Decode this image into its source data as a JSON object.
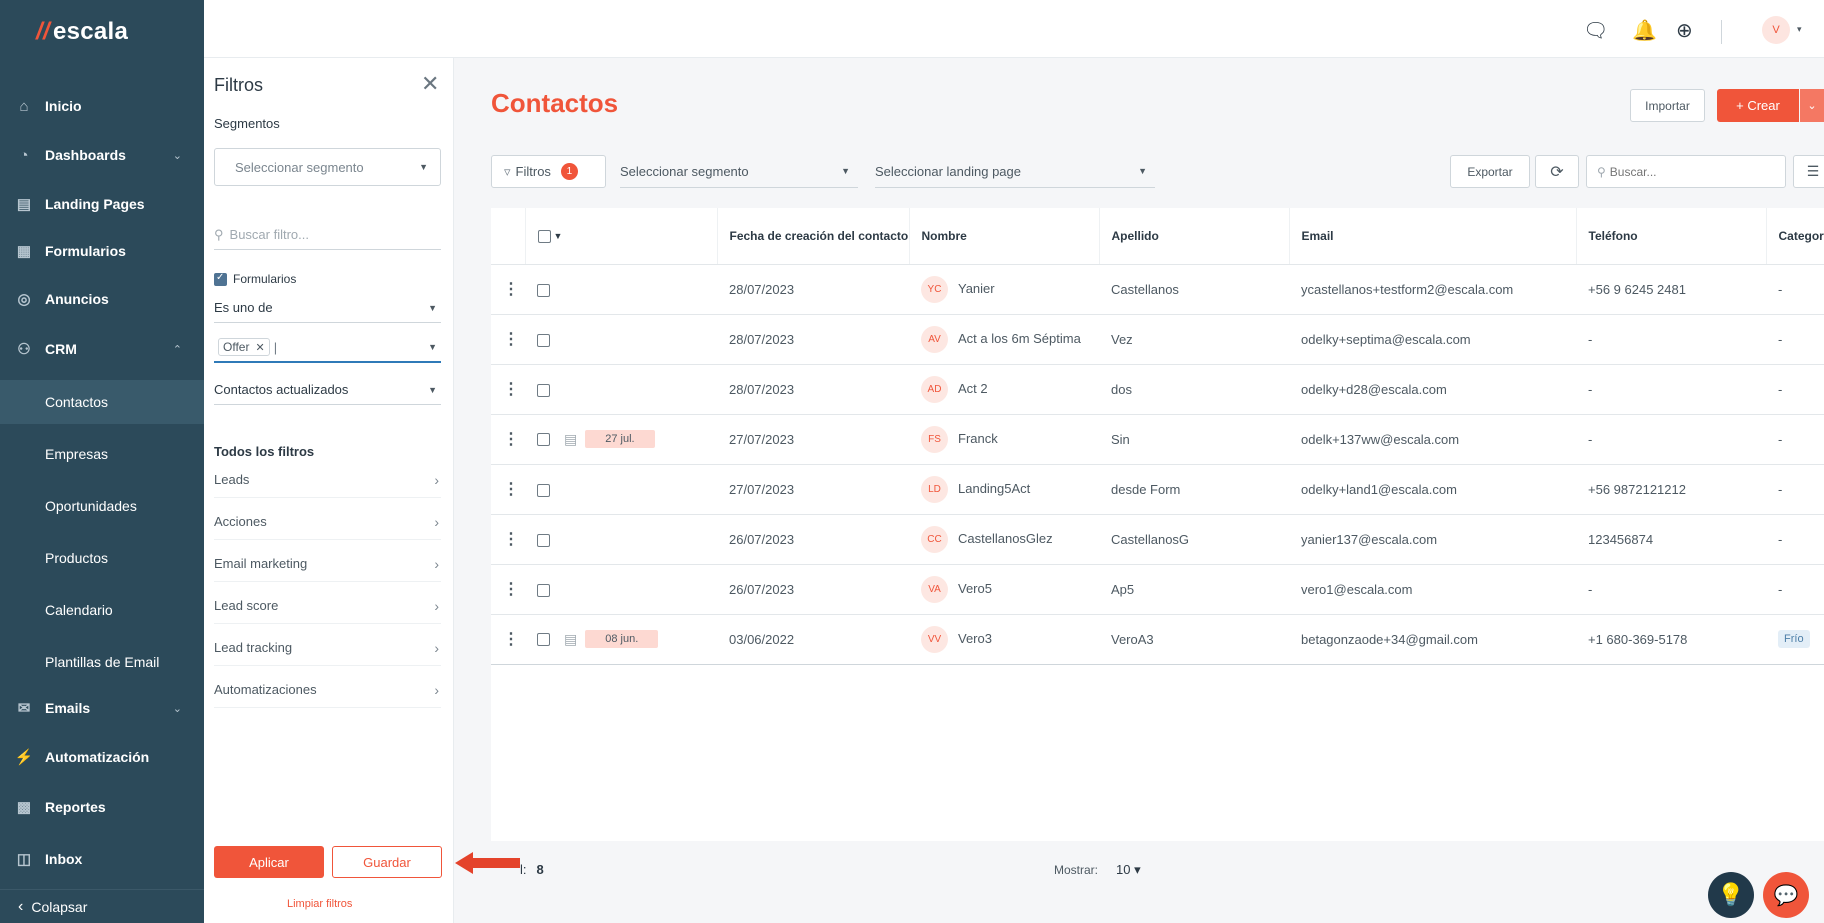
{
  "brand": {
    "logo_text": "escala",
    "logo_mark": "//",
    "accent": "#f0553a",
    "sidebar_bg": "#2c4a5a"
  },
  "sidebar": {
    "items": [
      {
        "label": "Inicio",
        "icon": "home-icon"
      },
      {
        "label": "Dashboards",
        "icon": "pie-chart-icon"
      },
      {
        "label": "Landing Pages",
        "icon": "page-icon"
      },
      {
        "label": "Formularios",
        "icon": "form-icon"
      },
      {
        "label": "Anuncios",
        "icon": "target-icon"
      },
      {
        "label": "CRM",
        "icon": "people-icon"
      },
      {
        "label": "Emails",
        "icon": "mail-icon"
      },
      {
        "label": "Automatización",
        "icon": "bolt-icon"
      },
      {
        "label": "Reportes",
        "icon": "report-icon"
      },
      {
        "label": "Inbox",
        "icon": "inbox-icon"
      }
    ],
    "crm_sub": [
      "Contactos",
      "Empresas",
      "Oportunidades",
      "Productos",
      "Calendario",
      "Plantillas de Email"
    ],
    "collapse_label": "Colapsar"
  },
  "filters": {
    "title": "Filtros",
    "segments_label": "Segmentos",
    "segment_placeholder": "Seleccionar segmento",
    "search_placeholder": "Buscar filtro...",
    "active_filter_label": "Formularios",
    "operator": "Es uno de",
    "tag_value": "Offer",
    "condition": "Contactos actualizados",
    "all_filters_label": "Todos los filtros",
    "categories": [
      "Leads",
      "Acciones",
      "Email marketing",
      "Lead score",
      "Lead tracking",
      "Automatizaciones"
    ],
    "apply_label": "Aplicar",
    "save_label": "Guardar",
    "clear_label": "Limpiar filtros"
  },
  "main": {
    "title": "Contactos",
    "import_label": "Importar",
    "create_label": "+ Crear",
    "filters_button": "Filtros",
    "filters_count": "1",
    "segment_select": "Seleccionar segmento",
    "landing_select": "Seleccionar landing page",
    "export_label": "Exportar",
    "search_placeholder": "Buscar...",
    "columns": [
      "Fecha de creación del contacto",
      "Nombre",
      "Apellido",
      "Email",
      "Teléfono",
      "Categor"
    ],
    "rows": [
      {
        "initials": "YC",
        "pill": "",
        "date": "28/07/2023",
        "nombre": "Yanier",
        "apellido": "Castellanos",
        "email": "ycastellanos+testform2@escala.com",
        "telefono": "+56 9 6245 2481",
        "categoria": "-"
      },
      {
        "initials": "AV",
        "pill": "",
        "date": "28/07/2023",
        "nombre": "Act a los 6m Séptima",
        "apellido": "Vez",
        "email": "odelky+septima@escala.com",
        "telefono": "-",
        "categoria": "-"
      },
      {
        "initials": "AD",
        "pill": "",
        "date": "28/07/2023",
        "nombre": "Act 2",
        "apellido": "dos",
        "email": "odelky+d28@escala.com",
        "telefono": "-",
        "categoria": "-"
      },
      {
        "initials": "FS",
        "pill": "27 jul.",
        "date": "27/07/2023",
        "nombre": "Franck",
        "apellido": "Sin",
        "email": "odelk+137ww@escala.com",
        "telefono": "-",
        "categoria": "-"
      },
      {
        "initials": "LD",
        "pill": "",
        "date": "27/07/2023",
        "nombre": "Landing5Act",
        "apellido": "desde Form",
        "email": "odelky+land1@escala.com",
        "telefono": "+56 9872121212",
        "categoria": "-"
      },
      {
        "initials": "CC",
        "pill": "",
        "date": "26/07/2023",
        "nombre": "CastellanosGlez",
        "apellido": "CastellanosG",
        "email": "yanier137@escala.com",
        "telefono": "123456874",
        "categoria": "-"
      },
      {
        "initials": "VA",
        "pill": "",
        "date": "26/07/2023",
        "nombre": "Vero5",
        "apellido": "Ap5",
        "email": "vero1@escala.com",
        "telefono": "-",
        "categoria": "-"
      },
      {
        "initials": "VV",
        "pill": "08 jun.",
        "date": "03/06/2022",
        "nombre": "Vero3",
        "apellido": "VeroA3",
        "email": "betagonzaode+34@gmail.com",
        "telefono": "+1 680-369-5178",
        "categoria": "Frío"
      }
    ],
    "total_prefix": "l:",
    "total_value": "8",
    "show_label": "Mostrar:",
    "show_value": "10"
  },
  "header": {
    "avatar_initial": "V"
  }
}
